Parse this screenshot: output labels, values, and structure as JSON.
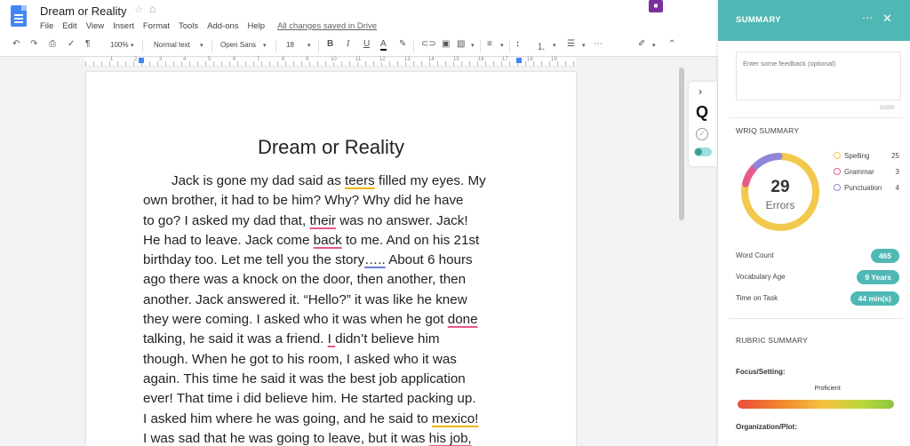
{
  "window": {
    "doc_title": "Dream or Reality",
    "save_status": "All changes saved in Drive"
  },
  "menu": [
    "File",
    "Edit",
    "View",
    "Insert",
    "Format",
    "Tools",
    "Add-ons",
    "Help"
  ],
  "toolbar": {
    "zoom": "100%",
    "style": "Normal text",
    "font": "Open Sans",
    "size": "18",
    "more": "⋯"
  },
  "ruler": {
    "labels": [
      "1",
      "2",
      "3",
      "4",
      "5",
      "6",
      "7",
      "8",
      "9",
      "10",
      "11",
      "12",
      "13",
      "14",
      "15",
      "16",
      "17",
      "18",
      "19"
    ]
  },
  "document": {
    "heading": "Dream or Reality",
    "lines": [
      "Jack is gone my dad said as teers filled my eyes. My",
      "own brother, it had to be him? Why? Why did he have",
      "to go? I asked my dad that, their was no answer. Jack!",
      "He had to leave. Jack come back to me. And on his 21st",
      "birthday too. Let me tell you the story….. About 6 hours",
      "ago there was a knock on the door, then another, then",
      "another. Jack answered it. “Hello?” it was like he knew",
      "they were coming. I asked who it was when he got done",
      "talking, he said it was a friend. I  didn’t believe him",
      "though. When he got to his room, I asked who it was",
      "again. This time he said it was the best job application",
      "ever! That time i did believe him. He started packing up.",
      "I asked him where he was going, and he said to mexico!",
      "I was sad that he was going to leave, but it was his job,"
    ]
  },
  "panel": {
    "title": "SUMMARY",
    "feedback_placeholder": "Enter some feedback (optional)",
    "feedback_count": "0/200",
    "wriq_title": "WRIQ SUMMARY",
    "errors": {
      "total": "29",
      "label": "Errors",
      "items": [
        {
          "name": "Spelling",
          "count": "25",
          "color": "#f2c94c"
        },
        {
          "name": "Grammar",
          "count": "3",
          "color": "#e8598a"
        },
        {
          "name": "Punctuation",
          "count": "4",
          "color": "#8f86d8"
        }
      ]
    },
    "stats": [
      {
        "label": "Word Count",
        "value": "465"
      },
      {
        "label": "Vocabulary Age",
        "value": "9 Years"
      },
      {
        "label": "Time on Task",
        "value": "44 min(s)"
      }
    ],
    "rubric_title": "RUBRIC SUMMARY",
    "rubric": [
      {
        "label": "Focus/Setting:",
        "level": "Proficient",
        "level_fraction": 0.6
      },
      {
        "label": "Organization/Plot:"
      }
    ]
  },
  "colors": {
    "accent": "#4fb8b4",
    "addon": "#7b2f9e",
    "docs_blue": "#4285f4"
  }
}
